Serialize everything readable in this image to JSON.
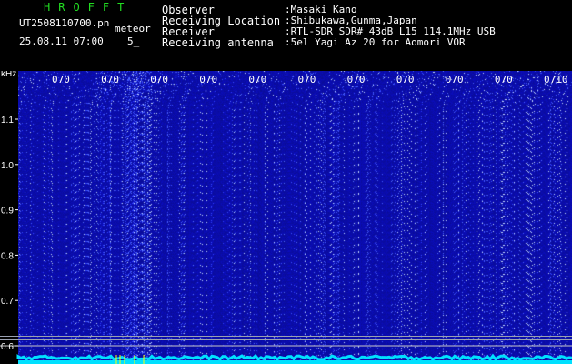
{
  "header": {
    "app_title": "HROFFT",
    "file_name": "UT2508110700.pn",
    "meteor_label": "meteor",
    "timestamp": "25.08.11 07:00",
    "count_label": "5_",
    "info": [
      {
        "key": "Observer",
        "value": ":Masaki Kano"
      },
      {
        "key": "Receiving Location",
        "value": ":Shibukawa,Gunma,Japan"
      },
      {
        "key": "Receiver",
        "value": ":RTL-SDR SDR# 43dB L15 114.1MHz USB"
      },
      {
        "key": "Receiving antenna",
        "value": ":5el Yagi Az 20 for Aomori VOR"
      }
    ]
  },
  "colors": {
    "background": "#000000",
    "spectrogram_base": "#0a0ca0",
    "title_green": "#22dd22",
    "signal_cyan": "#00e0ff",
    "marker_yellow": "#ffff00"
  },
  "chart_data": {
    "type": "heatmap",
    "title": "",
    "ylabel": "kHz",
    "x_tick_labels": [
      "070",
      "070",
      "070",
      "070",
      "070",
      "070",
      "070",
      "070",
      "070",
      "070",
      "0710"
    ],
    "y_ticks": [
      1.1,
      1.0,
      0.9,
      0.8,
      0.7,
      0.6
    ],
    "y_tick_labels": [
      "1.1",
      "1.0",
      "0.9",
      "0.8",
      "0.7",
      "0.6"
    ],
    "ylim": [
      0.57,
      1.2
    ],
    "reference_lines_khz": [
      0.6,
      0.613,
      0.621
    ],
    "bright_bands_minute": [
      2.5,
      1.3
    ],
    "grid": false
  }
}
